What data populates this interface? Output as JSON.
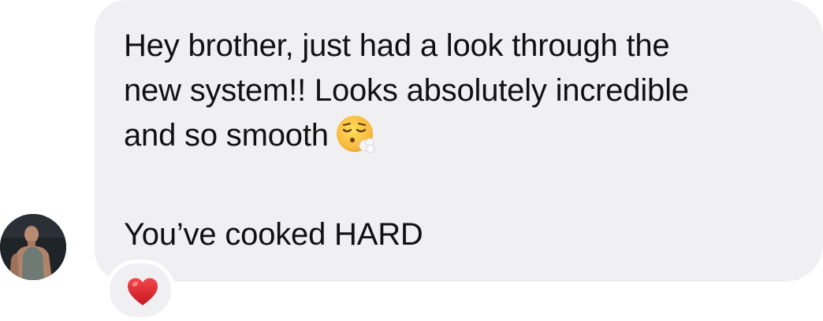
{
  "message": {
    "lines": [
      "Hey brother, just had a look through the",
      "new system!! Looks absolutely incredible",
      "and so smooth"
    ],
    "emoji": "face-exhaling-emoji",
    "second_paragraph": "You’ve cooked HARD"
  },
  "reaction": {
    "emoji": "red-heart-emoji"
  },
  "sender": {
    "avatar": "user-avatar"
  },
  "colors": {
    "bubble": "#f0f0f3",
    "text": "#111111",
    "heart": "#e0242c"
  }
}
